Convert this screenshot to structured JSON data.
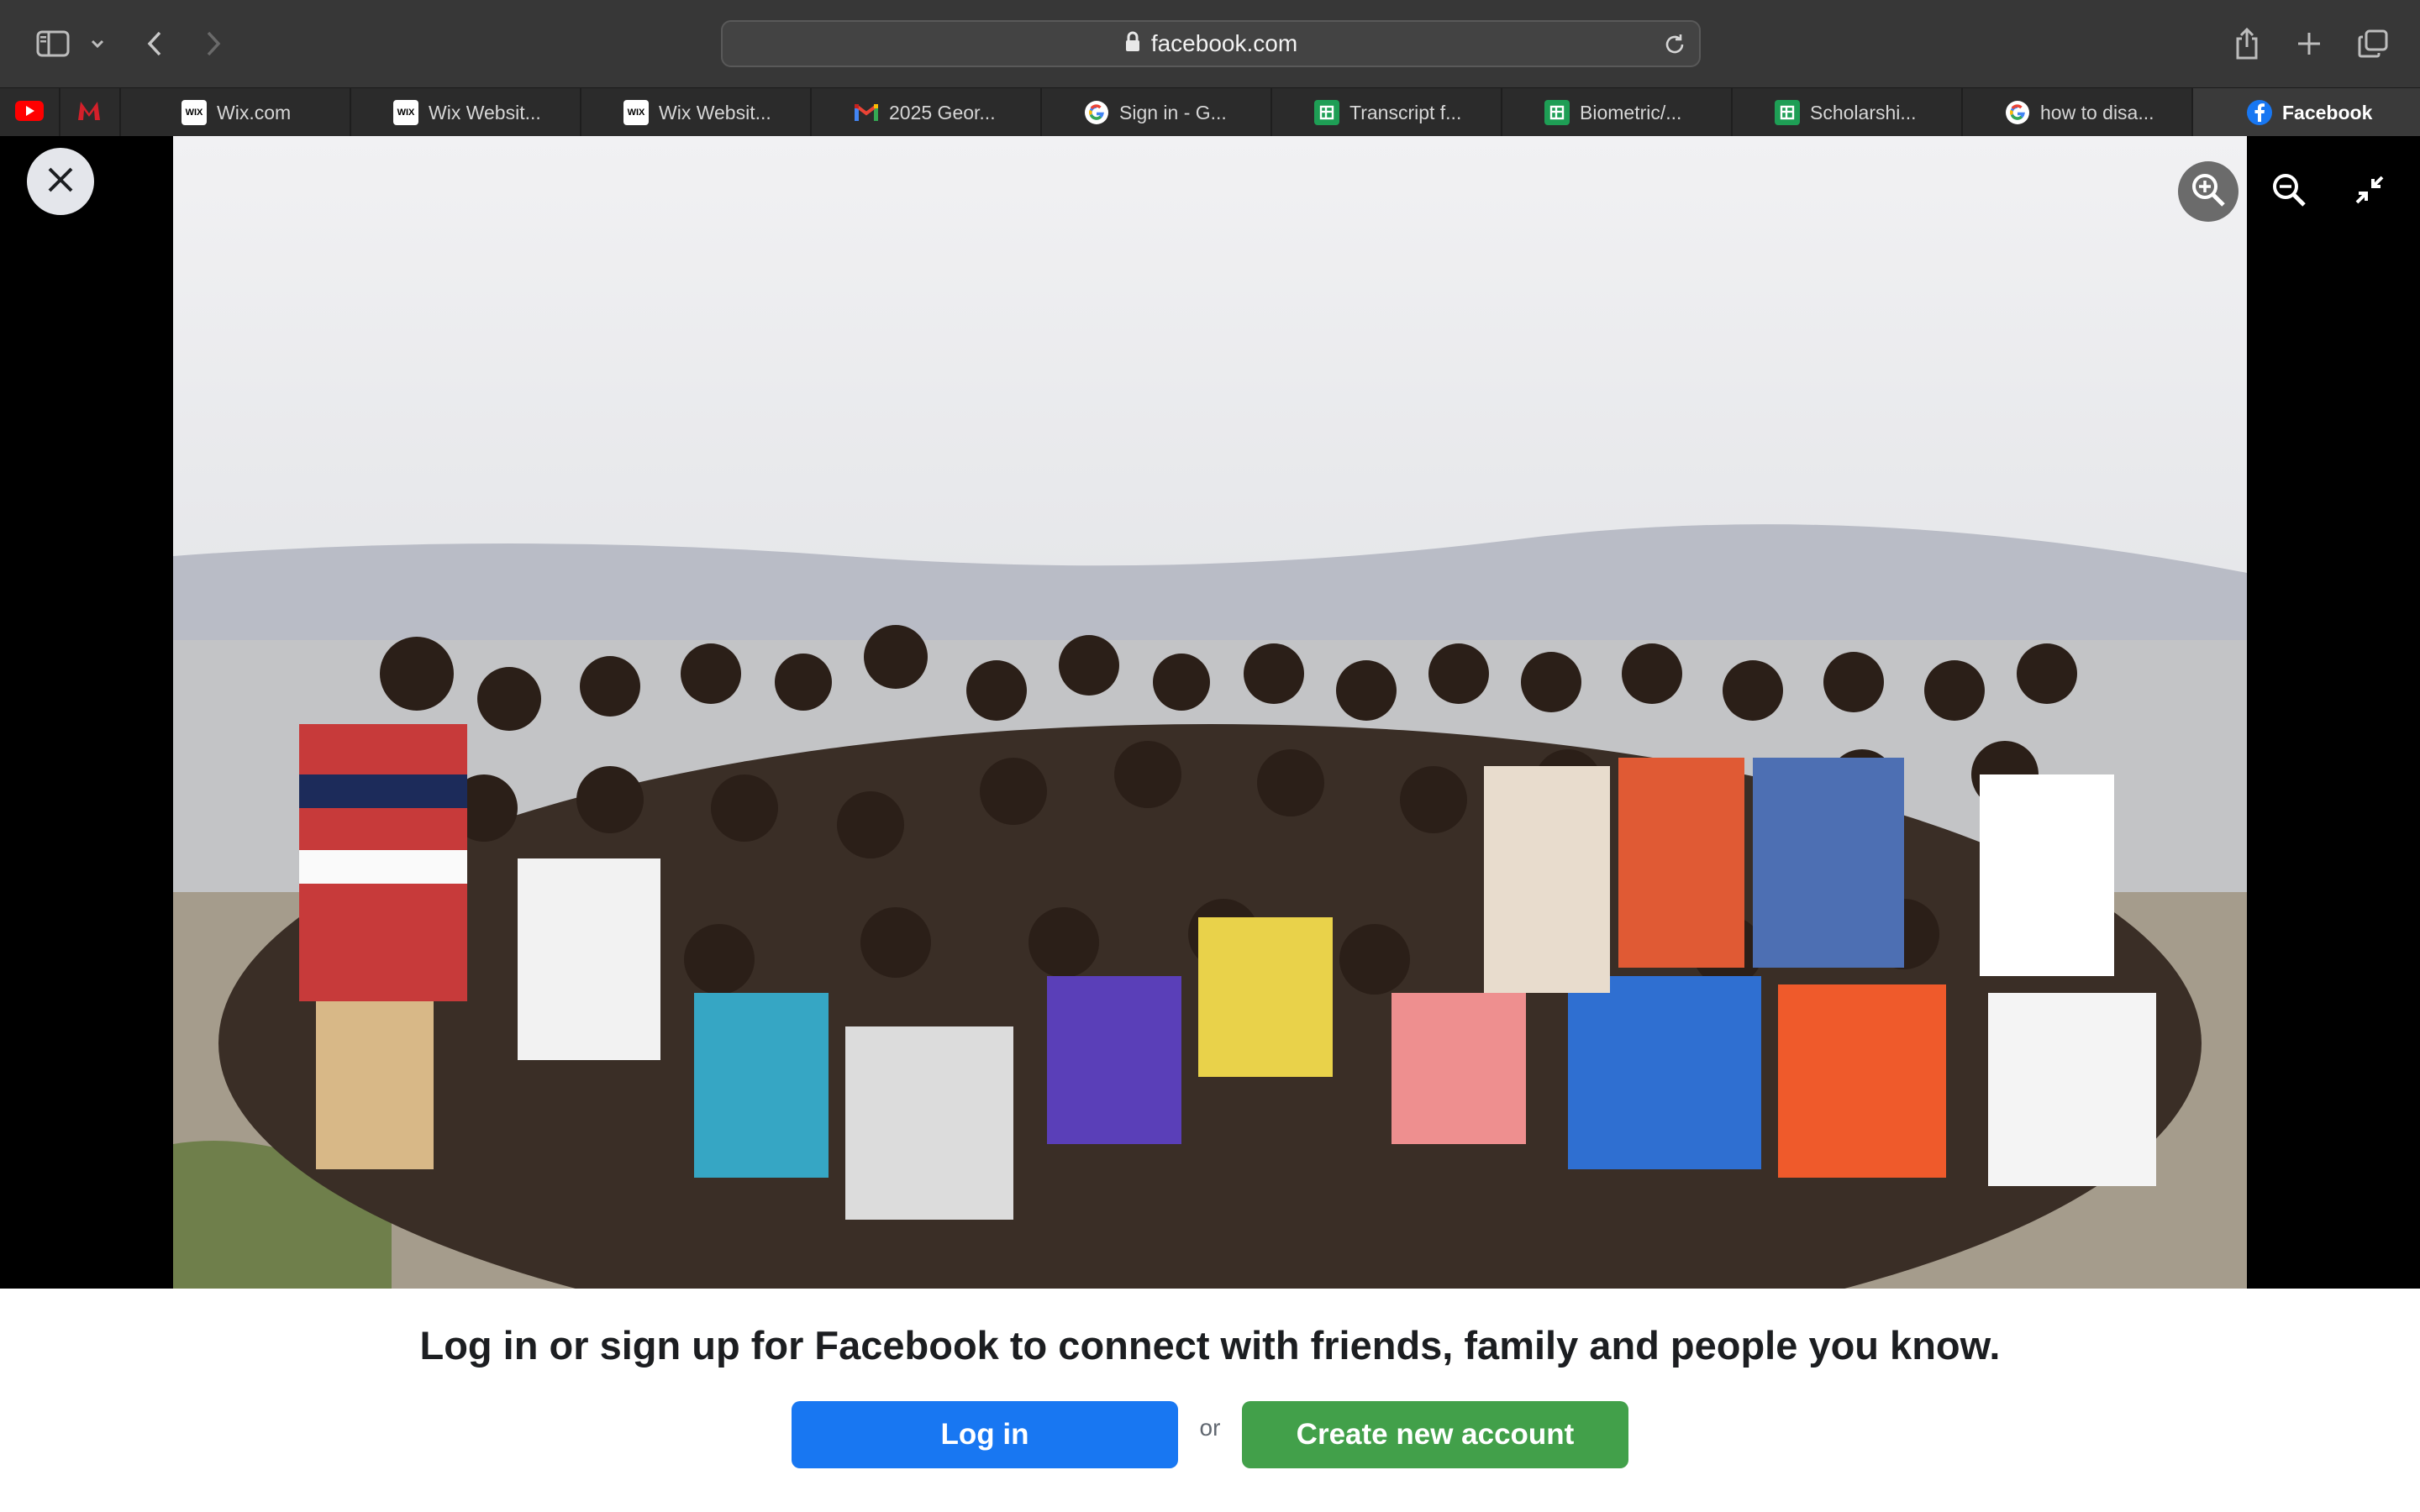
{
  "browser": {
    "url": "facebook.com",
    "tabs": [
      {
        "label": "Wix.com",
        "icon": "wix-icon"
      },
      {
        "label": "Wix Websit...",
        "icon": "wix-icon"
      },
      {
        "label": "Wix Websit...",
        "icon": "wix-icon"
      },
      {
        "label": "2025 Geor...",
        "icon": "gmail-icon"
      },
      {
        "label": "Sign in - G...",
        "icon": "google-icon"
      },
      {
        "label": "Transcript f...",
        "icon": "google-sheets-icon"
      },
      {
        "label": "Biometric/...",
        "icon": "google-sheets-icon"
      },
      {
        "label": "Scholarshi...",
        "icon": "google-sheets-icon"
      },
      {
        "label": "how to disa...",
        "icon": "google-icon"
      },
      {
        "label": "Facebook",
        "icon": "facebook-icon"
      }
    ],
    "pinned_tabs": [
      "youtube-icon",
      "mcgill-icon"
    ],
    "wix_favicon_text": "WIX"
  },
  "viewer": {
    "photo_description_icon": "group-photo-image"
  },
  "banner": {
    "message": "Log in or sign up for Facebook to connect with friends, family and people you know.",
    "login_label": "Log in",
    "or_label": "or",
    "create_label": "Create new account"
  },
  "colors": {
    "facebook_blue": "#1877f2",
    "create_green": "#42a04a",
    "chrome_dark": "#373737"
  }
}
